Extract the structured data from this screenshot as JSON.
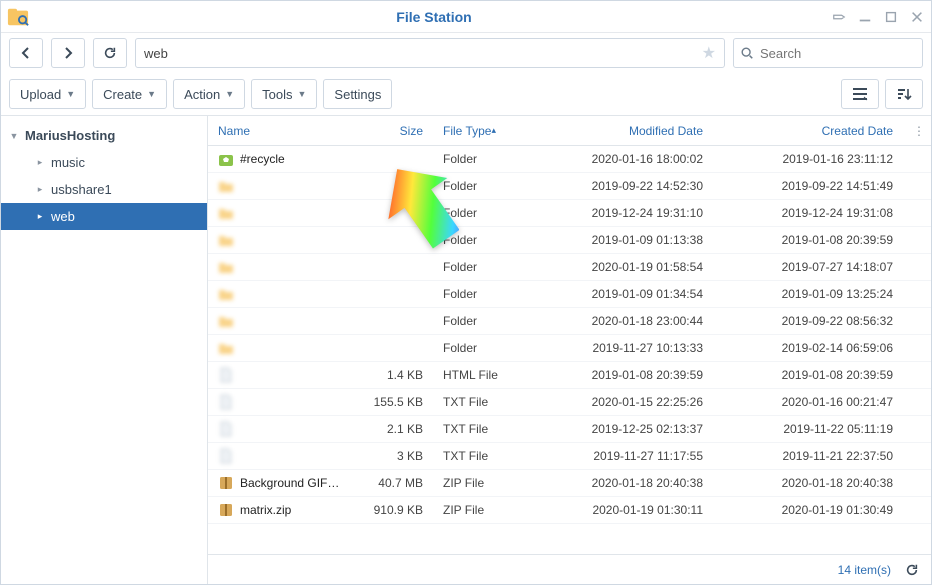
{
  "title": "File Station",
  "path": {
    "value": "web"
  },
  "search": {
    "placeholder": "Search"
  },
  "toolbar": {
    "upload": "Upload",
    "create": "Create",
    "action": "Action",
    "tools": "Tools",
    "settings": "Settings"
  },
  "sidebar": {
    "root": "MariusHosting",
    "items": [
      {
        "label": "music",
        "selected": false
      },
      {
        "label": "usbshare1",
        "selected": false
      },
      {
        "label": "web",
        "selected": true
      }
    ]
  },
  "columns": {
    "name": "Name",
    "size": "Size",
    "type": "File Type",
    "modified": "Modified Date",
    "created": "Created Date"
  },
  "rows": [
    {
      "name": "#recycle",
      "size": "",
      "type": "Folder",
      "modified": "2020-01-16 18:00:02",
      "created": "2019-01-16 23:11:12",
      "icon": "recycle",
      "visible": true
    },
    {
      "name": "",
      "size": "",
      "type": "Folder",
      "modified": "2019-09-22 14:52:30",
      "created": "2019-09-22 14:51:49",
      "icon": "folder",
      "visible": false
    },
    {
      "name": "",
      "size": "",
      "type": "Folder",
      "modified": "2019-12-24 19:31:10",
      "created": "2019-12-24 19:31:08",
      "icon": "folder",
      "visible": false
    },
    {
      "name": "",
      "size": "",
      "type": "Folder",
      "modified": "2019-01-09 01:13:38",
      "created": "2019-01-08 20:39:59",
      "icon": "folder",
      "visible": false
    },
    {
      "name": "",
      "size": "",
      "type": "Folder",
      "modified": "2020-01-19 01:58:54",
      "created": "2019-07-27 14:18:07",
      "icon": "folder",
      "visible": false
    },
    {
      "name": "",
      "size": "",
      "type": "Folder",
      "modified": "2019-01-09 01:34:54",
      "created": "2019-01-09 13:25:24",
      "icon": "folder",
      "visible": false
    },
    {
      "name": "",
      "size": "",
      "type": "Folder",
      "modified": "2020-01-18 23:00:44",
      "created": "2019-09-22 08:56:32",
      "icon": "folder",
      "visible": false
    },
    {
      "name": "",
      "size": "",
      "type": "Folder",
      "modified": "2019-11-27 10:13:33",
      "created": "2019-02-14 06:59:06",
      "icon": "folder",
      "visible": false
    },
    {
      "name": "",
      "size": "1.4 KB",
      "type": "HTML File",
      "modified": "2019-01-08 20:39:59",
      "created": "2019-01-08 20:39:59",
      "icon": "file",
      "visible": false
    },
    {
      "name": "",
      "size": "155.5 KB",
      "type": "TXT File",
      "modified": "2020-01-15 22:25:26",
      "created": "2020-01-16 00:21:47",
      "icon": "file",
      "visible": false
    },
    {
      "name": "",
      "size": "2.1 KB",
      "type": "TXT File",
      "modified": "2019-12-25 02:13:37",
      "created": "2019-11-22 05:11:19",
      "icon": "file",
      "visible": false
    },
    {
      "name": "",
      "size": "3 KB",
      "type": "TXT File",
      "modified": "2019-11-27 11:17:55",
      "created": "2019-11-21 22:37:50",
      "icon": "file",
      "visible": false
    },
    {
      "name": "Background GIF…",
      "size": "40.7 MB",
      "type": "ZIP File",
      "modified": "2020-01-18 20:40:38",
      "created": "2020-01-18 20:40:38",
      "icon": "zip",
      "visible": true
    },
    {
      "name": "matrix.zip",
      "size": "910.9 KB",
      "type": "ZIP File",
      "modified": "2020-01-19 01:30:11",
      "created": "2020-01-19 01:30:49",
      "icon": "zip",
      "visible": true
    }
  ],
  "status": {
    "count": "14 item(s)"
  }
}
